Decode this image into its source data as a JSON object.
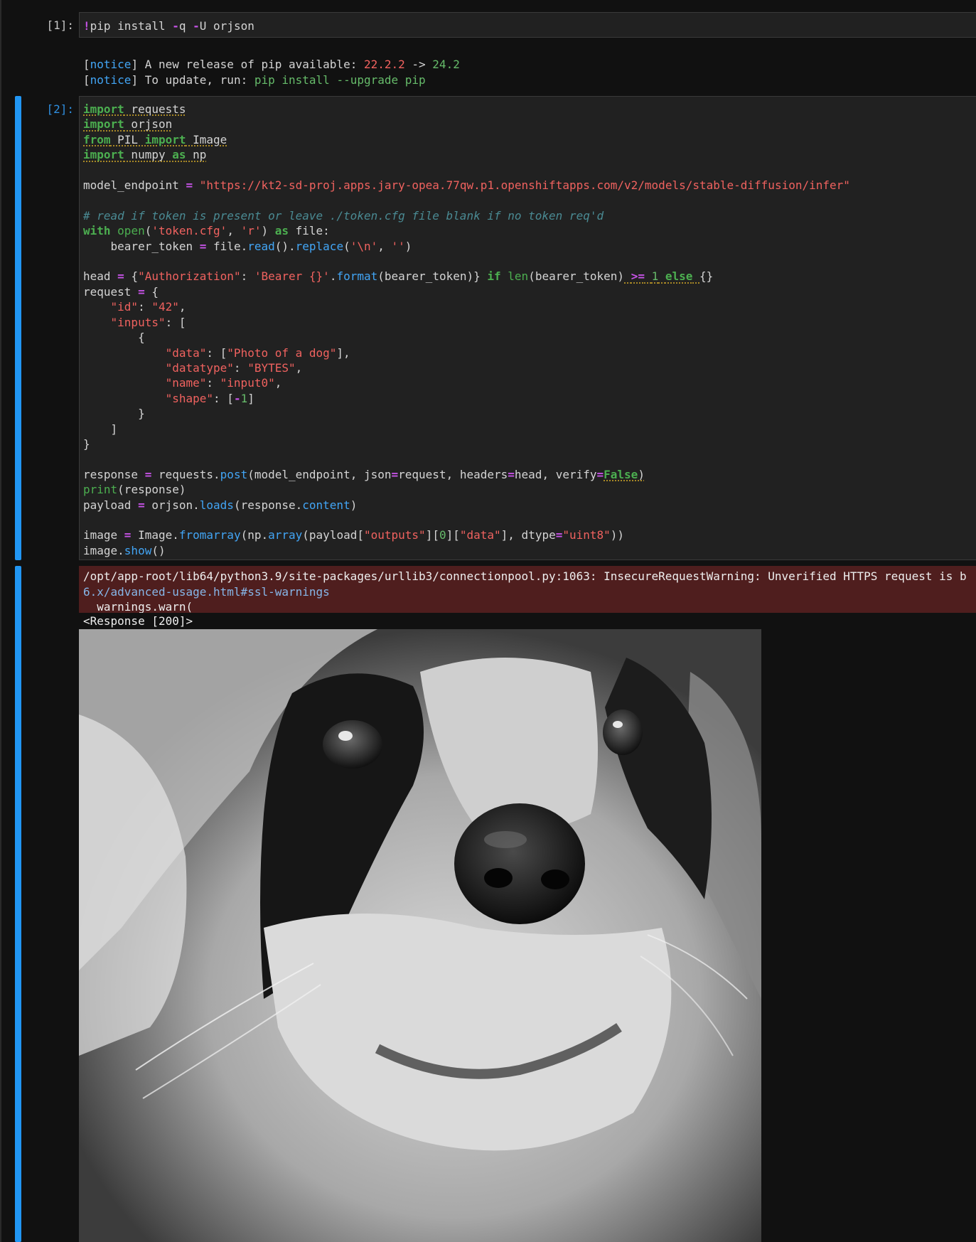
{
  "cell1": {
    "prompt": "[1]:",
    "input": {
      "bang": "!",
      "t1": "pip install ",
      "flag1": "-",
      "t2": "q ",
      "flag2": "-",
      "t3": "U orjson"
    },
    "notice": {
      "line1": {
        "open": "[",
        "tag": "notice",
        "close": "]",
        "text": " A new release of pip available: ",
        "old": "22.2.2",
        "arrow": " -> ",
        "new": "24.2"
      },
      "line2": {
        "open": "[",
        "tag": "notice",
        "close": "]",
        "text": " To update, run: ",
        "cmd": "pip install --upgrade pip"
      }
    }
  },
  "cell2": {
    "prompt": "[2]:",
    "endpoint_url": "\"https://kt2-sd-proj.apps.jary-opea.77qw.p1.openshiftapps.com/v2/models/stable-diffusion/infer\"",
    "comment": "# read if token is present or leave ./token.cfg file blank if no token req'd",
    "stderr": {
      "line1": "/opt/app-root/lib64/python3.9/site-packages/urllib3/connectionpool.py:1063: InsecureRequestWarning: Unverified HTTPS request is b",
      "line2": "6.x/advanced-usage.html#ssl-warnings",
      "line3": "  warnings.warn("
    },
    "stdout": "<Response [200]>",
    "image_alt": "Black and white photo of a dog"
  }
}
